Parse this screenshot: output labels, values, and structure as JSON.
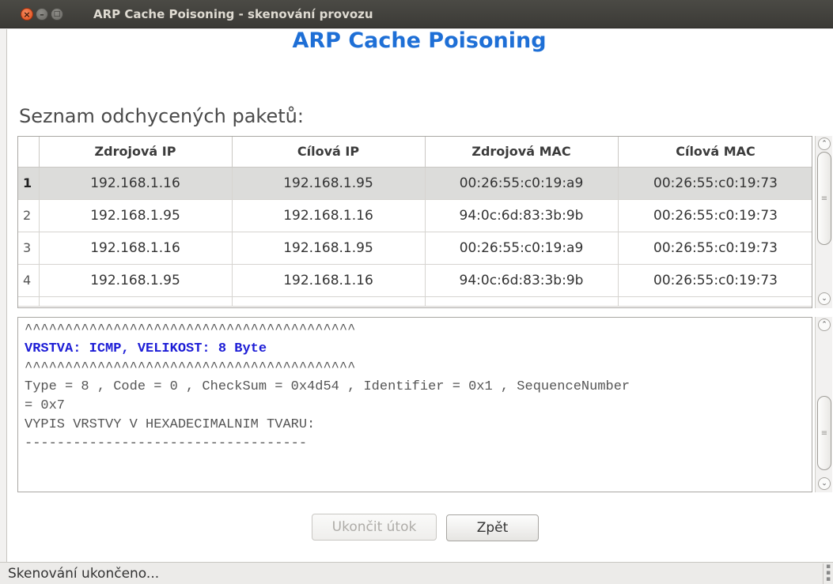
{
  "window": {
    "title": "ARP Cache Poisoning - skenování provozu",
    "close_glyph": "×",
    "min_glyph": "–",
    "max_glyph": "□"
  },
  "app": {
    "heading": "ARP Cache Poisoning",
    "list_label": "Seznam odchycených paketů:"
  },
  "table": {
    "columns": [
      "",
      "Zdrojová IP",
      "Cílová IP",
      "Zdrojová MAC",
      "Cílová MAC"
    ],
    "selected_row": 1,
    "rows": [
      {
        "n": "1",
        "src_ip": "192.168.1.16",
        "dst_ip": "192.168.1.95",
        "src_mac": "00:26:55:c0:19:a9",
        "dst_mac": "00:26:55:c0:19:73"
      },
      {
        "n": "2",
        "src_ip": "192.168.1.95",
        "dst_ip": "192.168.1.16",
        "src_mac": "94:0c:6d:83:3b:9b",
        "dst_mac": "00:26:55:c0:19:73"
      },
      {
        "n": "3",
        "src_ip": "192.168.1.16",
        "dst_ip": "192.168.1.95",
        "src_mac": "00:26:55:c0:19:a9",
        "dst_mac": "00:26:55:c0:19:73"
      },
      {
        "n": "4",
        "src_ip": "192.168.1.95",
        "dst_ip": "192.168.1.16",
        "src_mac": "94:0c:6d:83:3b:9b",
        "dst_mac": "00:26:55:c0:19:73"
      }
    ]
  },
  "detail": {
    "lines": [
      "^^^^^^^^^^^^^^^^^^^^^^^^^^^^^^^^^^^^^^^^^",
      "VRSTVA: ICMP, VELIKOST: 8 Byte",
      "^^^^^^^^^^^^^^^^^^^^^^^^^^^^^^^^^^^^^^^^^",
      "Type = 8 , Code = 0 , CheckSum = 0x4d54 , Identifier = 0x1 , SequenceNumber",
      "= 0x7",
      "",
      "VYPIS VRSTVY V HEXADECIMALNIM TVARU:",
      "-----------------------------------"
    ],
    "highlight_color": "#1d1dd6"
  },
  "buttons": {
    "stop_attack": "Ukončit útok",
    "back": "Zpět"
  },
  "status": {
    "text": "Skenování ukončeno..."
  },
  "scroll": {
    "up_glyph": "⌃",
    "down_glyph": "⌄",
    "grip_glyph": "≡"
  },
  "colors": {
    "heading": "#1e6fd6",
    "titlebar": "#3c3b37",
    "close_button": "#df4a16"
  }
}
